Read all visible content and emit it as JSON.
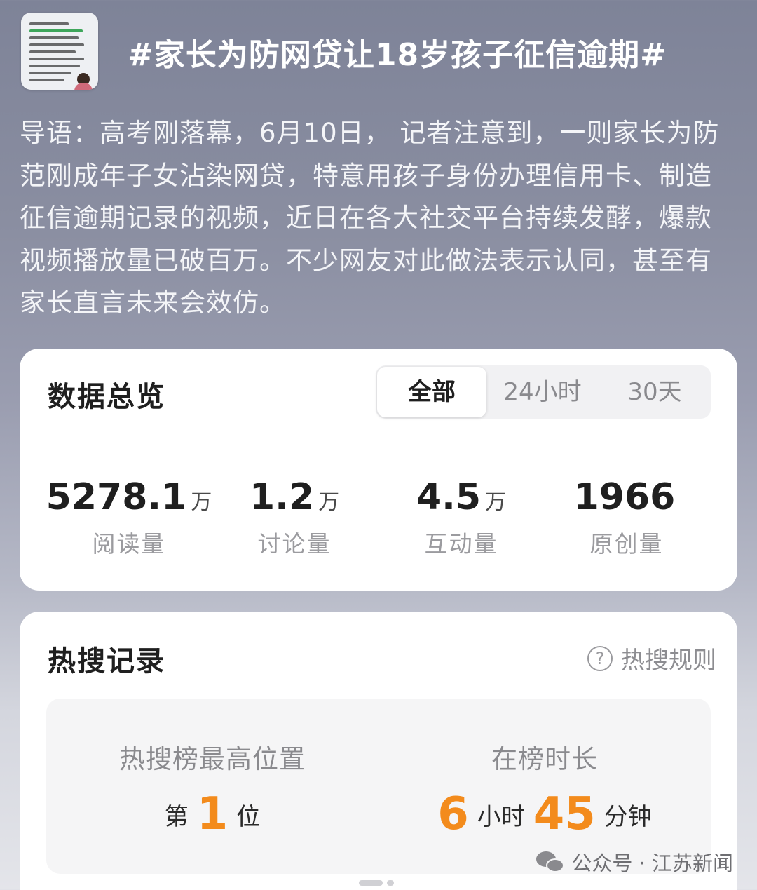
{
  "topic": {
    "title": "#家长为防网贷让18岁孩子征信逾期#",
    "thumbnail_alt": "为了防止孩子网贷，我在他十八岁生日那天给他办了张信用卡"
  },
  "intro": "导语：高考刚落幕，6月10日， 记者注意到，一则家长为防范刚成年子女沾染网贷，特意用孩子身份办理信用卡、制造征信逾期记录的视频，近日在各大社交平台持续发酵，爆款视频播放量已破百万。不少网友对此做法表示认同，甚至有家长直言未来会效仿。",
  "data_overview": {
    "title": "数据总览",
    "tabs": [
      {
        "label": "全部",
        "active": true
      },
      {
        "label": "24小时",
        "active": false
      },
      {
        "label": "30天",
        "active": false
      }
    ],
    "stats": [
      {
        "value": "5278.1",
        "unit": "万",
        "label": "阅读量"
      },
      {
        "value": "1.2",
        "unit": "万",
        "label": "讨论量"
      },
      {
        "value": "4.5",
        "unit": "万",
        "label": "互动量"
      },
      {
        "value": "1966",
        "unit": "",
        "label": "原创量"
      }
    ]
  },
  "hot_search": {
    "title": "热搜记录",
    "rule_label": "热搜规则",
    "peak": {
      "label": "热搜榜最高位置",
      "prefix": "第",
      "value": "1",
      "suffix": "位"
    },
    "duration": {
      "label": "在榜时长",
      "hours": "6",
      "hours_unit": "小时",
      "minutes": "45",
      "minutes_unit": "分钟"
    }
  },
  "watermark": {
    "text": "公众号 · 江苏新闻"
  },
  "colors": {
    "accent_orange": "#f38b1c",
    "card_bg": "#ffffff"
  }
}
